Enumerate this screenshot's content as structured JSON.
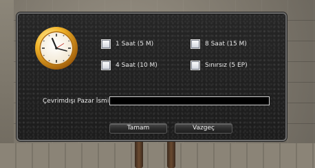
{
  "dialog": {
    "options": [
      {
        "label": "1 Saat (5 M)"
      },
      {
        "label": "8 Saat (15 M)"
      },
      {
        "label": "4 Saat (10 M)"
      },
      {
        "label": "Sınırsız (5 EP)"
      }
    ],
    "name_label": "Çevrimdışı Pazar İsmi:",
    "name_value": "",
    "ok_label": "Tamam",
    "cancel_label": "Vazgeç"
  },
  "icons": {
    "clock": "clock-icon",
    "checkbox": "checkbox-icon"
  },
  "colors": {
    "panel_bg": "#1f1f1f",
    "text": "#e9e9e9",
    "clock_gold": "#e0a020"
  }
}
